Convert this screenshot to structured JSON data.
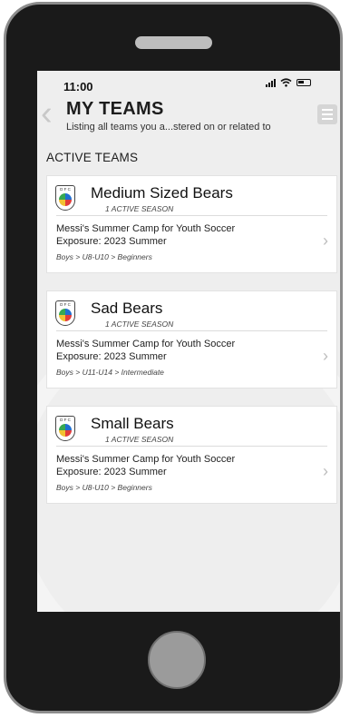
{
  "status_bar": {
    "time": "11:00"
  },
  "header": {
    "title": "MY TEAMS",
    "subtitle": "Listing all teams you a...stered on or related to"
  },
  "section_title": "ACTIVE TEAMS",
  "teams": [
    {
      "name": "Medium Sized Bears",
      "season_count": "1 ACTIVE SEASON",
      "program": "Messi's Summer Camp for Youth Soccer",
      "season": "Exposure: 2023 Summer",
      "path": "Boys > U8-U10 > Beginners"
    },
    {
      "name": "Sad Bears",
      "season_count": "1 ACTIVE SEASON",
      "program": "Messi's Summer Camp for Youth Soccer",
      "season": "Exposure: 2023 Summer",
      "path": "Boys > U11-U14 > Intermediate"
    },
    {
      "name": "Small Bears",
      "season_count": "1 ACTIVE SEASON",
      "program": "Messi's Summer Camp for Youth Soccer",
      "season": "Exposure: 2023 Summer",
      "path": "Boys > U8-U10 > Beginners"
    }
  ],
  "logo_text": "D F C",
  "icons": {
    "back": "chevron-left-icon",
    "menu": "hamburger-menu-icon",
    "row_action": "chevron-right-icon"
  },
  "colors": {
    "screen_background": "#eeeeee",
    "phone_body": "#1a1a1a",
    "card_background": "#ffffff"
  }
}
